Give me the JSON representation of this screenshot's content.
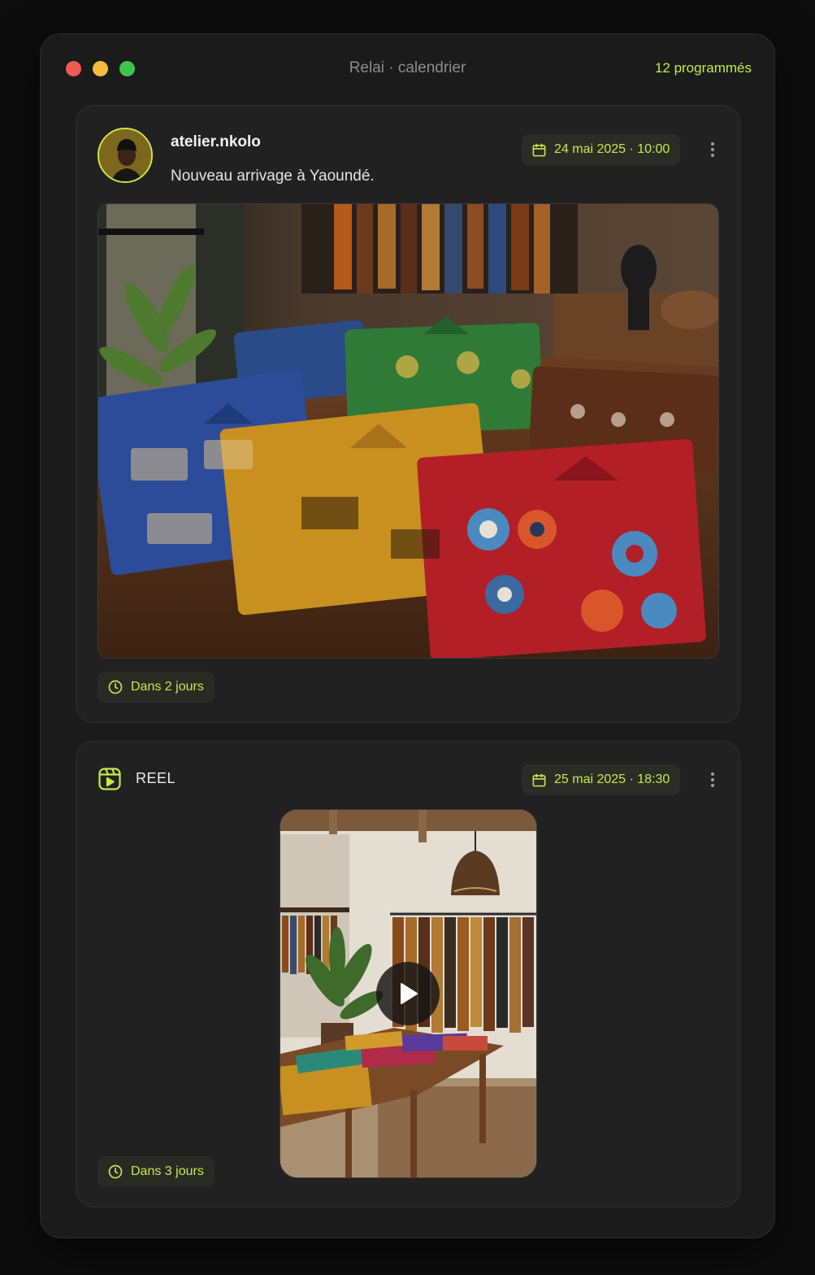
{
  "window": {
    "title": "Relai · calendrier",
    "scheduled_count": "12 programmés"
  },
  "colors": {
    "accent": "#c9e84a",
    "background": "#0d0d0d",
    "window": "#1b1b1b",
    "card": "#212121"
  },
  "posts": [
    {
      "type": "post",
      "author": "atelier.nkolo",
      "caption": "Nouveau arrivage à Yaoundé.",
      "scheduled_date": "24 mai 2025 · 10:00",
      "countdown": "Dans 2 jours",
      "icons": {
        "date": "calendar-icon",
        "countdown": "clock-icon",
        "menu": "more-vertical-icon"
      }
    },
    {
      "type": "reel",
      "type_label": "REEL",
      "scheduled_date": "25 mai 2025 · 18:30",
      "countdown": "Dans 3 jours",
      "icons": {
        "type": "reel-icon",
        "date": "calendar-icon",
        "countdown": "clock-icon",
        "menu": "more-vertical-icon",
        "play": "play-icon"
      }
    }
  ]
}
